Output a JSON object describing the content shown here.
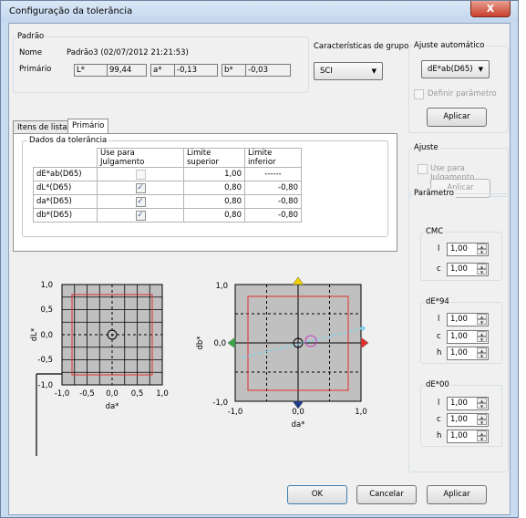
{
  "window": {
    "title": "Configuração da tolerância",
    "close_label": "X"
  },
  "standard": {
    "group_label": "Padrão",
    "name_label": "Nome",
    "name_value": "Padrão3 (02/07/2012 21:21:53)",
    "primary_label": "Primário",
    "L_label": "L*",
    "L_value": "99,44",
    "a_label": "a*",
    "a_value": "-0,13",
    "b_label": "b*",
    "b_value": "-0,03"
  },
  "group_characteristics": {
    "label": "Características de grupo",
    "value": "SCI"
  },
  "auto_adjust": {
    "label": "Ajuste automático",
    "value": "dE*ab(D65)",
    "define_param_label": "Definir parâmetro",
    "apply_label": "Aplicar"
  },
  "tabs": [
    {
      "label": "Itens de lista",
      "selected": false
    },
    {
      "label": "Primário",
      "selected": true
    }
  ],
  "tolerance": {
    "group_label": "Dados da tolerância",
    "headers": [
      "",
      "Use para Julgamento",
      "Limite superior",
      "Limite inferior"
    ],
    "rows": [
      {
        "name": "dE*ab(D65)",
        "checked": false,
        "upper": "1,00",
        "lower": "------"
      },
      {
        "name": "dL*(D65)",
        "checked": true,
        "upper": "0,80",
        "lower": "-0,80"
      },
      {
        "name": "da*(D65)",
        "checked": true,
        "upper": "0,80",
        "lower": "-0,80"
      },
      {
        "name": "db*(D65)",
        "checked": true,
        "upper": "0,80",
        "lower": "-0,80"
      }
    ]
  },
  "adjust": {
    "group_label": "Ajuste",
    "use_judgment_label": "Use para Julgamento",
    "apply_label": "Aplicar"
  },
  "parameter": {
    "group_label": "Parâmetro",
    "cmc": {
      "label": "CMC",
      "l_label": "l",
      "l_value": "1,00",
      "c_label": "c",
      "c_value": "1,00"
    },
    "de94": {
      "label": "dE*94",
      "l_label": "l",
      "l_value": "1,00",
      "c_label": "c",
      "c_value": "1,00",
      "h_label": "h",
      "h_value": "1,00"
    },
    "de00": {
      "label": "dE*00",
      "l_label": "l",
      "l_value": "1,00",
      "c_label": "c",
      "c_value": "1,00",
      "h_label": "h",
      "h_value": "1,00"
    }
  },
  "plot_left": {
    "ylabel": "dL*",
    "xlabel": "da*",
    "yticks": [
      "1,0",
      "0,5",
      "0,0",
      "-0,5",
      "-1,0"
    ],
    "xticks": [
      "-1,0",
      "-0,5",
      "0,0",
      "0,5",
      "1,0"
    ]
  },
  "plot_right": {
    "ylabel": "db*",
    "xlabel": "da*",
    "yticks": [
      "1,0",
      "0,0",
      "-1,0"
    ],
    "xticks": [
      "-1,0",
      "0,0",
      "1,0"
    ]
  },
  "buttons": {
    "ok": "OK",
    "cancel": "Cancelar",
    "apply": "Aplicar"
  },
  "colors": {
    "tolerance_box": "#e0302a",
    "plot_bg": "#c0c0c0",
    "vector": "#7fd3ec"
  }
}
